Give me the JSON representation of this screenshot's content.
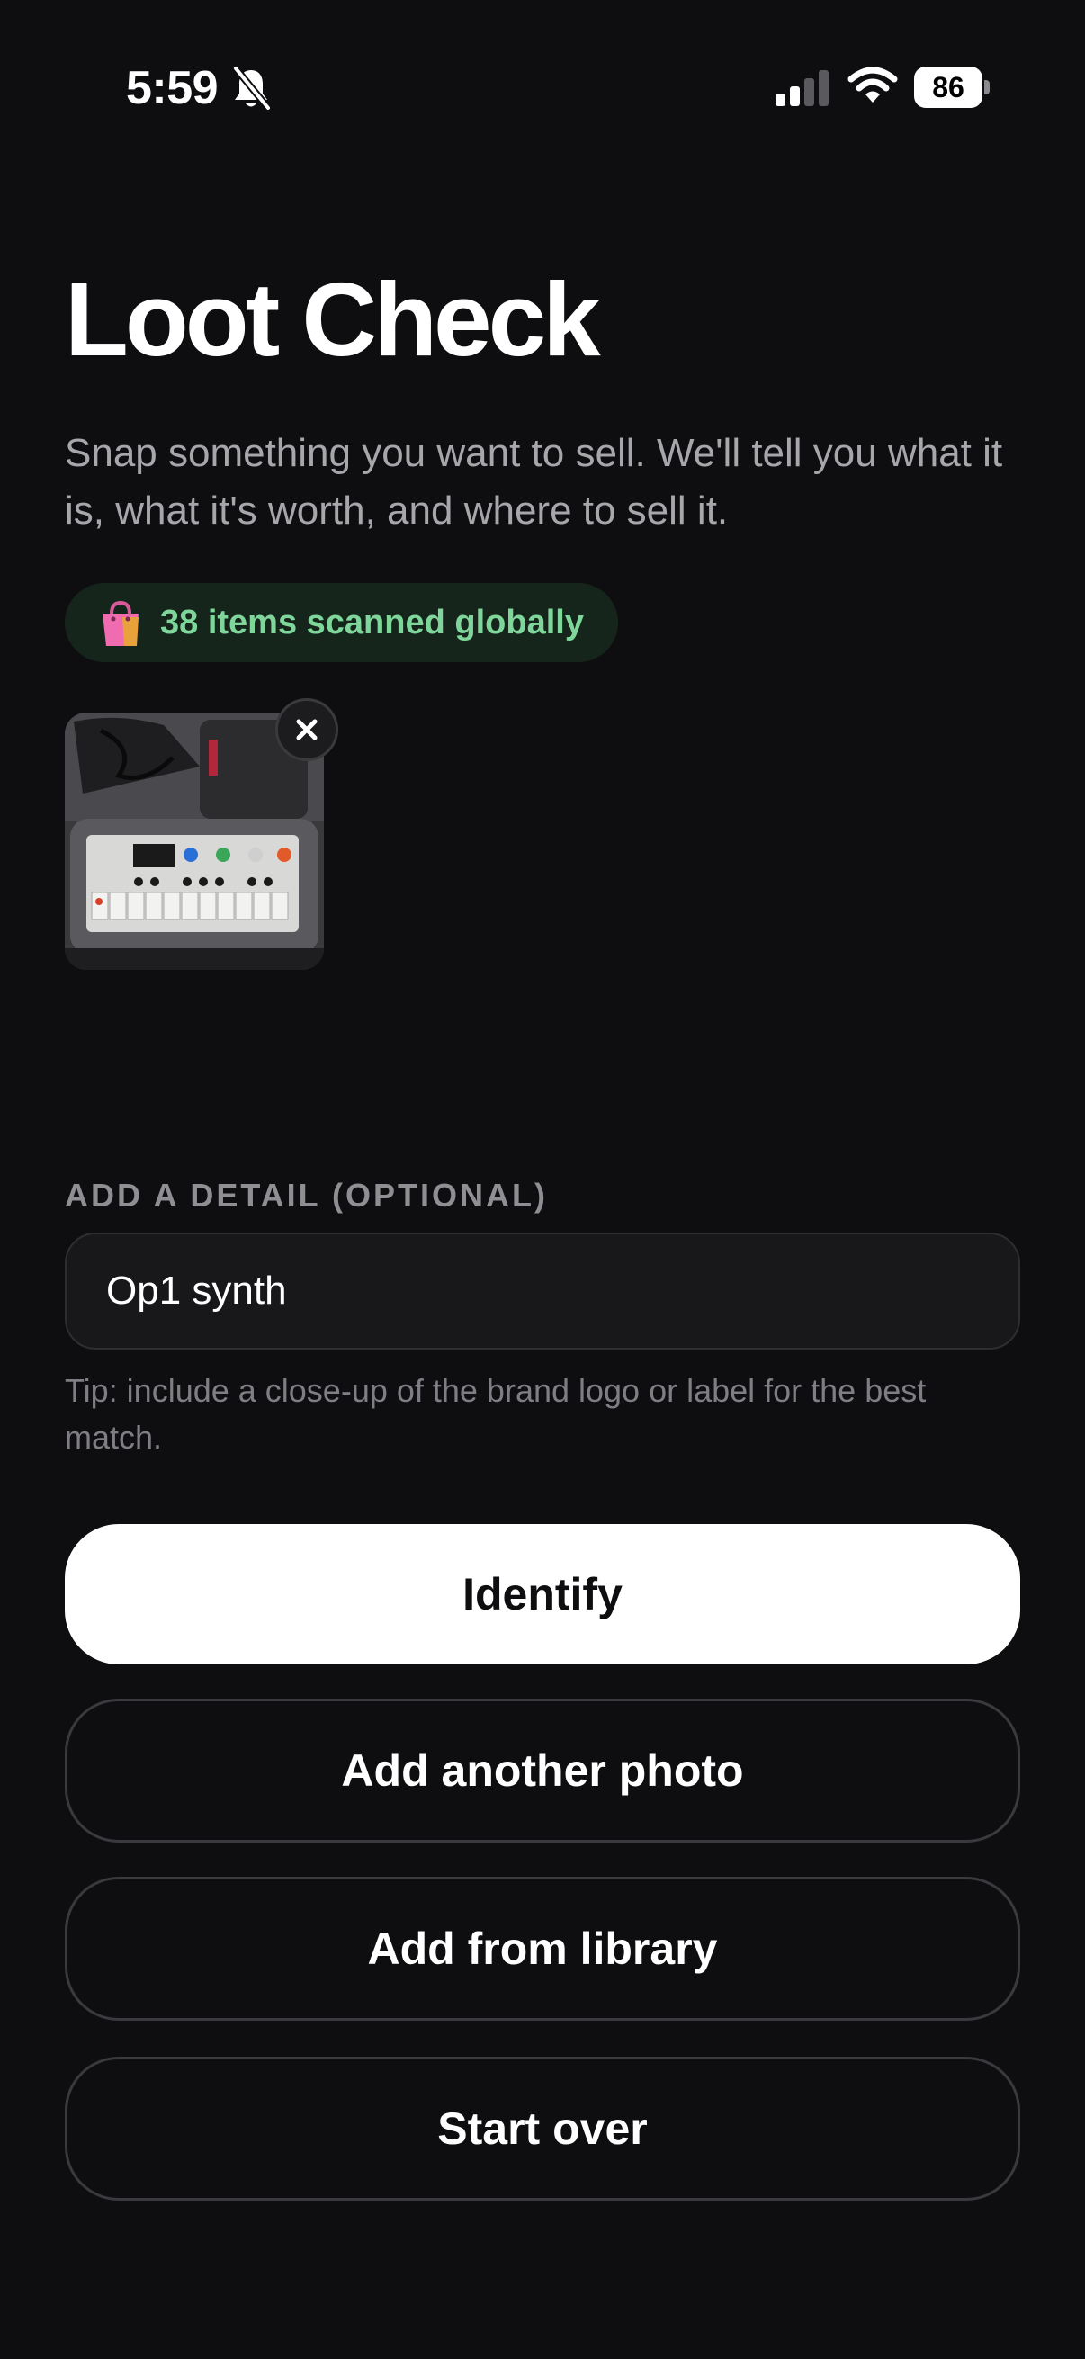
{
  "status_bar": {
    "time": "5:59",
    "battery": "86",
    "icons": [
      "bell-off-icon",
      "signal-icon",
      "wifi-icon",
      "battery-icon"
    ]
  },
  "header": {
    "title": "Loot Check",
    "subtitle": "Snap something you want to sell. We'll tell you what it is, what it's worth, and where to sell it."
  },
  "badge": {
    "icon": "shopping-bags-icon",
    "text": "38 items scanned globally"
  },
  "photo": {
    "remove_icon": "close-icon"
  },
  "detail": {
    "label": "ADD A DETAIL (OPTIONAL)",
    "value": "Op1 synth",
    "tip": "Tip: include a close-up of the brand logo or label for the best match."
  },
  "actions": {
    "identify": "Identify",
    "add_another": "Add another photo",
    "add_library": "Add from library",
    "start_over": "Start over"
  },
  "colors": {
    "background": "#0e0e10",
    "badge_bg": "#16251c",
    "badge_text": "#7fd69a",
    "primary_button": "#ffffff"
  }
}
